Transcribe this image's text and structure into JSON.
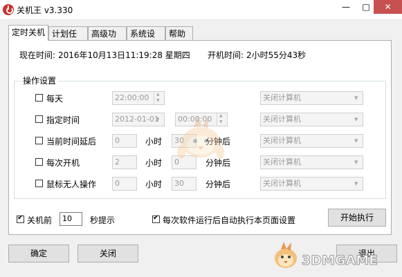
{
  "window": {
    "title": "关机王 v3.330",
    "controls": {
      "minimize": "—",
      "maximize": "□",
      "close": "✕"
    }
  },
  "tabs": [
    {
      "label": "定时关机",
      "active": true
    },
    {
      "label": "计划任务",
      "active": false
    },
    {
      "label": "高级功能",
      "active": false
    },
    {
      "label": "系统设置",
      "active": false
    },
    {
      "label": "帮助",
      "active": false
    }
  ],
  "info": {
    "current_time_label": "现在时间:",
    "current_time_value": "2016年10月13日11:19:28 星期四",
    "uptime_label": "开机时间:",
    "uptime_value": "2小时55分43秒"
  },
  "group": {
    "label": "操作设置",
    "rows": [
      {
        "label": "每天",
        "checked": false,
        "time": "22:00:00",
        "action": "关闭计算机"
      },
      {
        "label": "指定时间",
        "checked": false,
        "date": "2012-01-01",
        "time": "00:00:00",
        "action": "关闭计算机"
      },
      {
        "label": "当前时间延后",
        "checked": false,
        "hours": "0",
        "unit_hours": "小时",
        "minutes": "30",
        "unit_minutes": "分钟后",
        "action": "关闭计算机"
      },
      {
        "label": "每次开机",
        "checked": false,
        "hours": "2",
        "unit_hours": "小时",
        "minutes": "0",
        "unit_minutes": "分钟后",
        "action": "关闭计算机"
      },
      {
        "label": "鼠标无人操作",
        "checked": false,
        "hours": "0",
        "unit_hours": "小时",
        "minutes": "30",
        "unit_minutes": "分钟后",
        "action": "关闭计算机"
      }
    ]
  },
  "options": {
    "prompt_before": {
      "label": "关机前",
      "checked": true,
      "value": "10",
      "suffix": "秒提示"
    },
    "auto_run": {
      "label": "每次软件运行后自动执行本页面设置",
      "checked": true
    },
    "start_button": "开始执行"
  },
  "footer": {
    "ok_button": "确定",
    "close_button": "关闭",
    "exit_button": "退出"
  },
  "watermark": "3DMGAME"
}
